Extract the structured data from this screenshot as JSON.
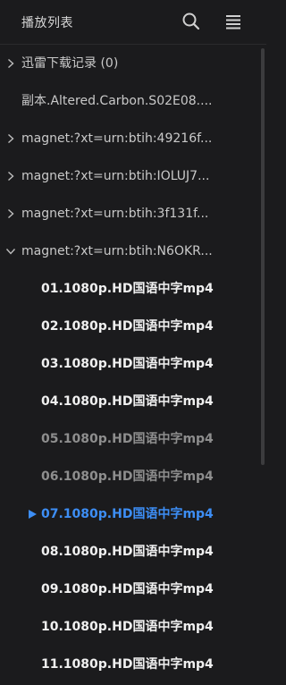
{
  "header": {
    "title": "播放列表",
    "search_icon": "search-icon",
    "menu_icon": "list-menu-icon"
  },
  "colors": {
    "background": "#1b1b1d",
    "current_item": "#3d8ef5",
    "watched_item": "#8e8e8e",
    "unwatched_item": "#f0f0f0"
  },
  "playlist": {
    "folders": [
      {
        "label": "迅雷下载记录 (0)",
        "chevron": "chevron-right-icon"
      },
      {
        "label": "副本.Altered.Carbon.S02E08...."
      },
      {
        "label": "magnet:?xt=urn:btih:49216f...",
        "chevron": "chevron-right-icon"
      },
      {
        "label": "magnet:?xt=urn:btih:IOLUJ7...",
        "chevron": "chevron-right-icon"
      },
      {
        "label": "magnet:?xt=urn:btih:3f131f...",
        "chevron": "chevron-right-icon"
      },
      {
        "label": "magnet:?xt=urn:btih:N6OKR...",
        "chevron": "chevron-down-icon"
      }
    ],
    "expanded_items": [
      {
        "label": "01.1080p.HD国语中字mp4",
        "state": "unwatched"
      },
      {
        "label": "02.1080p.HD国语中字mp4",
        "state": "unwatched"
      },
      {
        "label": "03.1080p.HD国语中字mp4",
        "state": "unwatched"
      },
      {
        "label": "04.1080p.HD国语中字mp4",
        "state": "unwatched"
      },
      {
        "label": "05.1080p.HD国语中字mp4",
        "state": "watched"
      },
      {
        "label": "06.1080p.HD国语中字mp4",
        "state": "watched"
      },
      {
        "label": "07.1080p.HD国语中字mp4",
        "state": "current"
      },
      {
        "label": "08.1080p.HD国语中字mp4",
        "state": "unwatched"
      },
      {
        "label": "09.1080p.HD国语中字mp4",
        "state": "unwatched"
      },
      {
        "label": "10.1080p.HD国语中字mp4",
        "state": "unwatched"
      },
      {
        "label": "11.1080p.HD国语中字mp4",
        "state": "unwatched"
      }
    ]
  }
}
